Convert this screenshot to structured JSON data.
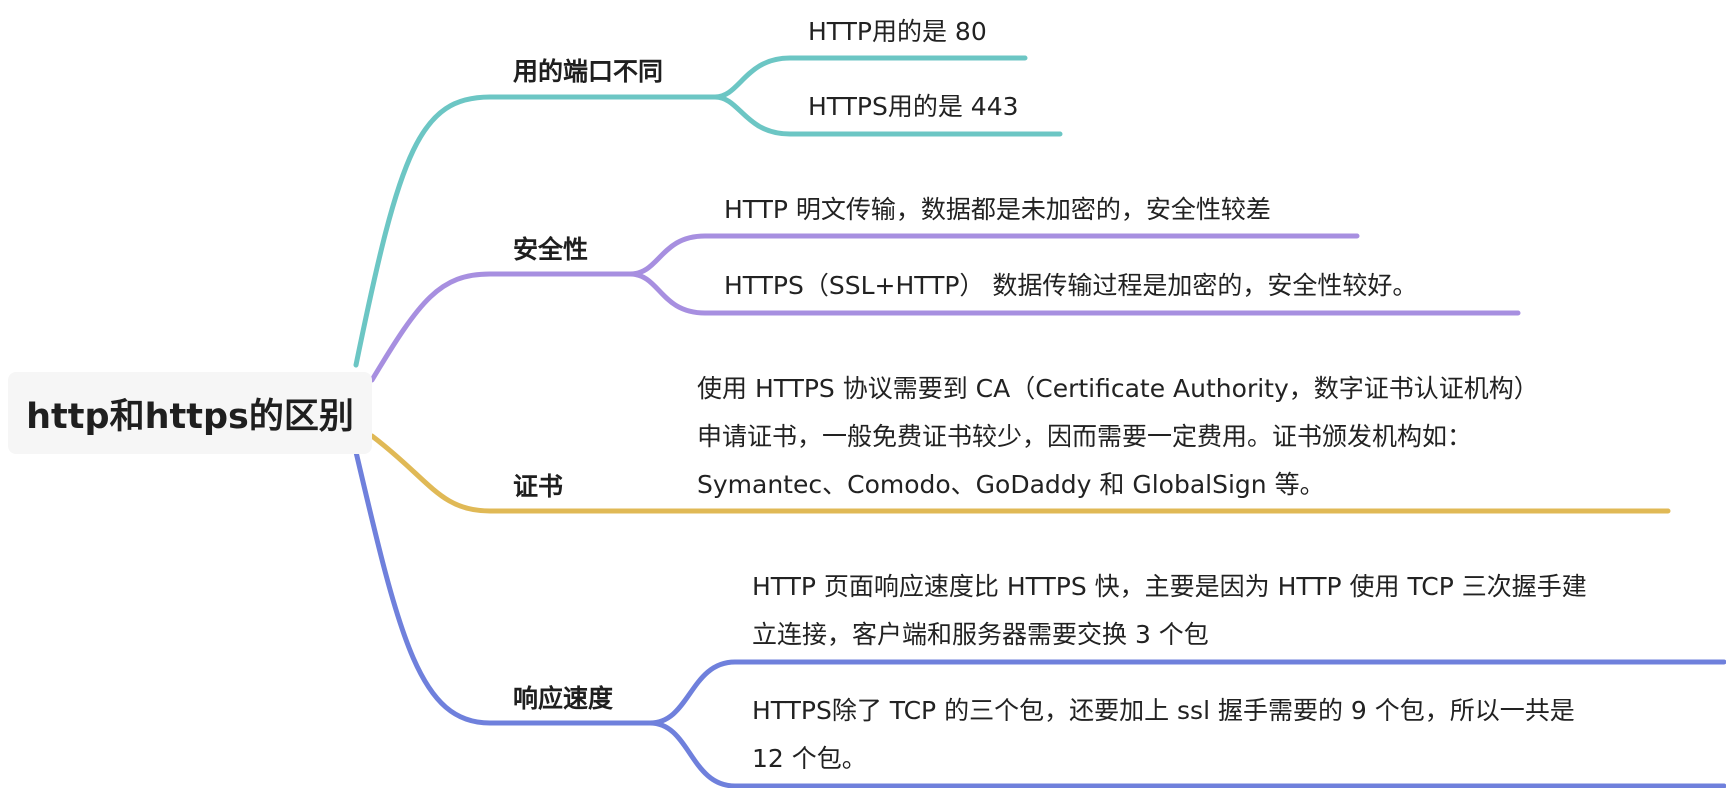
{
  "root": {
    "label": "http和https的区别"
  },
  "colors": {
    "ports": "#6cc6c4",
    "security": "#a78fe0",
    "certificate": "#e0b956",
    "speed": "#6f80dc"
  },
  "branches": [
    {
      "label": "用的端口不同",
      "leaves": [
        "HTTP用的是 80",
        "HTTPS用的是 443"
      ]
    },
    {
      "label": "安全性",
      "leaves": [
        "HTTP 明文传输，数据都是未加密的，安全性较差",
        "HTTPS（SSL+HTTP） 数据传输过程是加密的，安全性较好。"
      ]
    },
    {
      "label": "证书",
      "leaves": [
        "使用 HTTPS 协议需要到 CA（Certificate Authority，数字证书认证机构）",
        "申请证书，一般免费证书较少，因而需要一定费用。证书颁发机构如：",
        "Symantec、Comodo、GoDaddy 和 GlobalSign 等。"
      ]
    },
    {
      "label": "响应速度",
      "leaves": [
        "HTTP 页面响应速度比 HTTPS 快，主要是因为 HTTP 使用 TCP 三次握手建",
        "立连接，客户端和服务器需要交换 3 个包",
        "HTTPS除了 TCP 的三个包，还要加上 ssl 握手需要的 9 个包，所以一共是",
        "12 个包。"
      ]
    }
  ]
}
